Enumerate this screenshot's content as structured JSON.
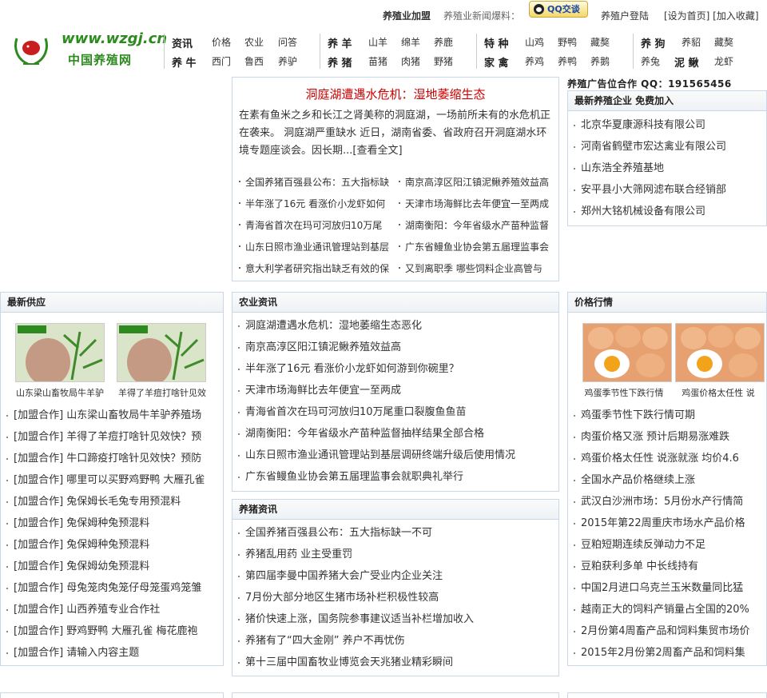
{
  "topbar": {
    "join": "养殖业加盟",
    "tip": "养殖业新闻爆料：",
    "qq_label": "QQ交谈",
    "login": "养殖户登陆",
    "home_fav": "[设为首页] [加入收藏]"
  },
  "logo": {
    "url": "www.wzgj.cn",
    "name": "中国养殖网"
  },
  "nav": {
    "group1": [
      [
        "资讯",
        "价格",
        "农业",
        "问答"
      ],
      [
        "养 牛",
        "西门",
        "鲁西",
        "养驴"
      ]
    ],
    "group2": [
      [
        "养 羊",
        "山羊",
        "绵羊",
        "养鹿"
      ],
      [
        "养 猪",
        "苗猪",
        "肉猪",
        "野猪"
      ]
    ],
    "group3": [
      [
        "特 种",
        "山鸡",
        "野鸭",
        "藏獒"
      ],
      [
        "家 禽",
        "养鸡",
        "养鸭",
        "养鹅"
      ]
    ],
    "group4": [
      [
        "养 狗",
        "养貂",
        "藏獒"
      ],
      [
        "养兔",
        "泥 鳅",
        "龙虾"
      ]
    ]
  },
  "feature": {
    "title": "洞庭湖遭遇水危机：湿地萎缩生态",
    "intro": "在素有鱼米之乡和长江之肾美称的洞庭湖，一场前所未有的水危机正在袭来。 洞庭湖严重缺水 近日，湖南省委、省政府召开洞庭湖水环境专题座谈会。因长期...[查看全文]",
    "headlines": [
      [
        "全国养猪百强县公布：五大指标缺",
        "南京高淳区阳江镇泥鳅养殖效益高"
      ],
      [
        "半年涨了16元 看涨价小龙虾如何",
        "天津市场海鲜比去年便宜一至两成"
      ],
      [
        "青海省首次在玛可河放归10万尾",
        "湖南衡阳：今年省级水产苗种监督"
      ],
      [
        "山东日照市渔业通讯管理站到基层",
        "广东省鳗鱼业协会第五届理监事会"
      ],
      [
        "意大利学者研究指出缺乏有效的保",
        "又到离职季 哪些饲料企业高管与"
      ]
    ]
  },
  "ad": {
    "title": "养殖广告位合作 QQ：191565456"
  },
  "new_companies": {
    "title": "最新养殖企业 免费加入",
    "items": [
      "北京华夏康源科技有限公司",
      "河南省鹤壁市宏达禽业有限公司",
      "山东浩全养殖基地",
      "安平县小大筛网滤布联合经销部",
      "郑州大铭机械设备有限公司"
    ]
  },
  "supply": {
    "title": "最新供应",
    "thumbs": [
      "山东梁山畜牧局牛羊驴",
      "羊得了羊痘打啥针见效"
    ],
    "tag": "[加盟合作]",
    "items": [
      "山东梁山畜牧局牛羊驴养殖场",
      "羊得了羊痘打啥针见效快？预",
      "牛口蹄疫打啥针见效快？预防",
      "哪里可以买野鸡野鸭 大雁孔雀",
      "兔保姆长毛兔专用预混料",
      "兔保姆种兔预混料",
      "兔保姆种兔预混料",
      "兔保姆幼兔预混料",
      "母兔笼肉兔笼仔母笼蛋鸡笼雏",
      "山西养殖专业合作社",
      "野鸡野鸭 大雁孔雀 梅花鹿袍",
      "请输入内容主题"
    ]
  },
  "agri_news": {
    "title": "农业资讯",
    "items": [
      "洞庭湖遭遇水危机：湿地萎缩生态恶化",
      "南京高淳区阳江镇泥鳅养殖效益高",
      "半年涨了16元 看涨价小龙虾如何游到你碗里？",
      "天津市场海鲜比去年便宜一至两成",
      "青海省首次在玛可河放归10万尾重口裂腹鱼鱼苗",
      "湖南衡阳：今年省级水产苗种监督抽样结果全部合格",
      "山东日照市渔业通讯管理站到基层调研终端升级后使用情况",
      "广东省鳗鱼业协会第五届理监事会就职典礼举行"
    ]
  },
  "pig_news": {
    "title": "养猪资讯",
    "items": [
      "全国养猪百强县公布：五大指标缺一不可",
      "养猪乱用药 业主受重罚",
      "第四届李曼中国养猪大会广受业内企业关注",
      "7月份大部分地区生猪市场补栏积极性较高",
      "猪价快速上涨，国务院参事建议适当补栏增加收入",
      "养猪有了“四大金刚” 养户不再忧伤",
      "第十三届中国畜牧业博览会天兆猪业精彩瞬间"
    ]
  },
  "prices": {
    "title": "价格行情",
    "thumbs": [
      "鸡蛋季节性下跌行情",
      "鸡蛋价格太任性 说"
    ],
    "items": [
      "鸡蛋季节性下跌行情可期",
      "肉蛋价格又涨 预计后期易涨难跌",
      "鸡蛋价格太任性 说涨就涨 均价4.6",
      "全国水产品价格继续上涨",
      "武汉白沙洲市场：5月份水产行情简",
      "2015年第22周重庆市场水产品价格",
      "豆粕短期连续反弹动力不足",
      "豆粕获利多单 中长线持有",
      "中国2月进口乌克兰玉米数量同比猛",
      "越南正大的饲料产销量占全国的20%",
      "2月份第4周畜产品和饲料集贸市场价",
      "2015年2月份第2周畜产品和饲料集"
    ]
  },
  "colors": {
    "accent_red": "#cc0000",
    "logo_green": "#2c8a1e",
    "border": "#c8d8e8"
  }
}
